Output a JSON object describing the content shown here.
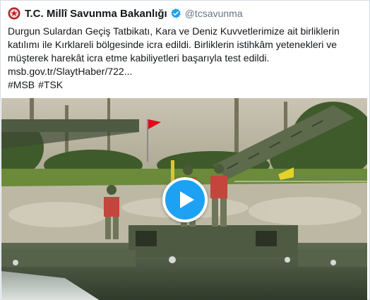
{
  "account": {
    "display_name": "T.C. Millî Savunma Bakanlığı",
    "handle": "@tcsavunma",
    "verified_icon": "verified-badge-icon",
    "avatar_icon": "ministry-emblem-icon"
  },
  "tweet": {
    "lines": [
      "Durgun Sulardan Geçiş Tatbikatı, Kara ve Deniz Kuvvetlerimize ait birliklerin",
      "katılımı ile Kırklareli bölgesinde icra edildi. Birliklerin istihkâm yetenekleri ve",
      "müşterek harekât icra etme kabiliyetleri başarıyla test edildi."
    ],
    "link": "msb.gov.tr/SlaytHaber/722...",
    "hashtags": [
      "#MSB",
      "#TSK"
    ]
  },
  "media": {
    "type": "video",
    "play_icon": "play-icon"
  },
  "colors": {
    "accent": "#1da1f2",
    "handle_gray": "#657786",
    "flag_red": "#e30a17"
  }
}
